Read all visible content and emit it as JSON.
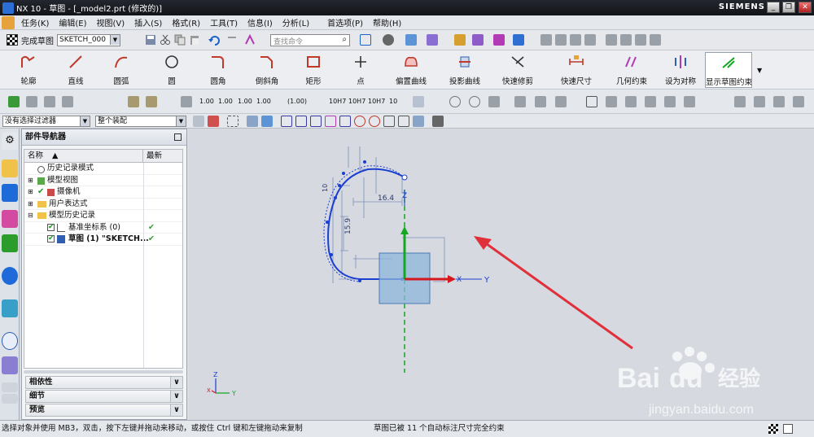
{
  "window": {
    "title": "NX 10 - 草图 - [_model2.prt (修改的)]",
    "brand": "SIEMENS"
  },
  "menu": [
    "任务(K)",
    "编辑(E)",
    "视图(V)",
    "插入(S)",
    "格式(R)",
    "工具(T)",
    "信息(I)",
    "分析(L)",
    "首选项(P)",
    "帮助(H)"
  ],
  "toolbar": {
    "finish_sketch": "完成草图",
    "sketch_name": "SKETCH_000",
    "search_placeholder": "查找命令"
  },
  "ribbon": [
    "轮廓",
    "直线",
    "圆弧",
    "圆",
    "圆角",
    "倒斜角",
    "矩形",
    "点",
    "偏置曲线",
    "投影曲线",
    "快速修剪",
    "快速尺寸",
    "几何约束",
    "设为对称",
    "显示草图约束"
  ],
  "dim_tools": [
    "1.00",
    "1.00",
    "1.00",
    "1.00",
    "(1.00)",
    "10H7",
    "10H7",
    "10H7",
    "10"
  ],
  "filter": {
    "selection": "没有选择过滤器",
    "scope": "整个装配"
  },
  "navigator": {
    "title": "部件导航器",
    "col_name": "名称",
    "col_latest": "最新",
    "items": [
      {
        "label": "历史记录模式",
        "latest": ""
      },
      {
        "label": "模型视图",
        "latest": ""
      },
      {
        "label": "摄像机",
        "latest": ""
      },
      {
        "label": "用户表达式",
        "latest": ""
      },
      {
        "label": "模型历史记录",
        "latest": ""
      },
      {
        "label": "基准坐标系 (0)",
        "latest": "✔"
      },
      {
        "label": "草图 (1) \"SKETCH...",
        "latest": "✔"
      }
    ],
    "sections": [
      "相依性",
      "细节",
      "预览"
    ]
  },
  "sketch": {
    "dims": [
      "16.4",
      "15.9",
      "10"
    ],
    "axis_x": "X",
    "axis_y": "Y",
    "axis_z": "Z",
    "triad_x": "X",
    "triad_y": "Y",
    "triad_z": "Z"
  },
  "watermark": {
    "brand": "Bai",
    "brand2": "du",
    "cn": "经验",
    "url": "jingyan.baidu.com"
  },
  "status": {
    "left": "选择对象并使用 MB3，双击，按下左键并拖动来移动，或按住 Ctrl 键和左键拖动来复制",
    "right": "草图已被 11 个自动标注尺寸完全约束"
  },
  "colors": {
    "accent": "#1a3fd1",
    "arrow": "#e0303a",
    "axis_green": "#13a822",
    "axis_red": "#d4181e"
  }
}
